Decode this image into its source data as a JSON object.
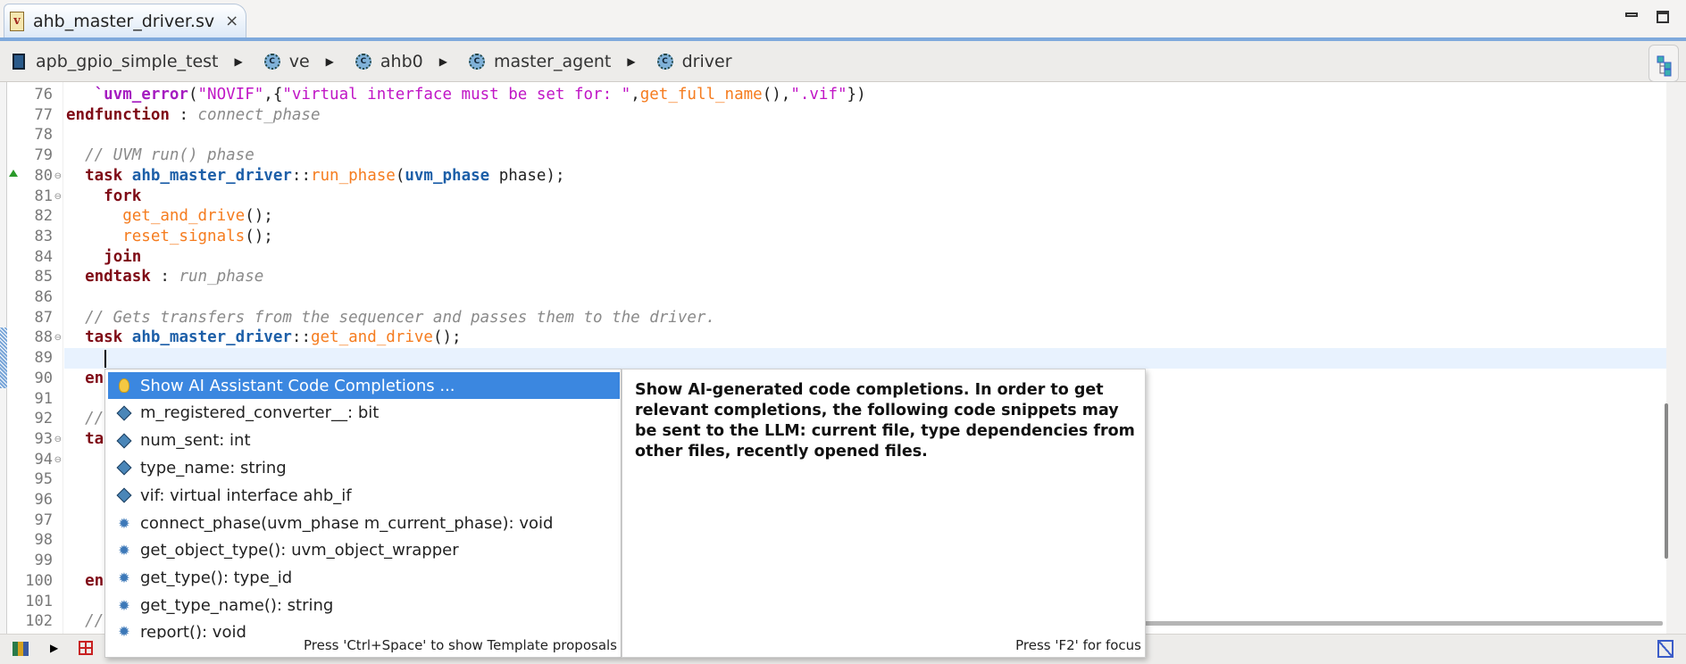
{
  "tab": {
    "title": "ahb_master_driver.sv",
    "file_icon": "sv-file-icon",
    "close": "×"
  },
  "breadcrumb": [
    "apb_gpio_simple_test",
    "ve",
    "ahb0",
    "master_agent",
    "driver"
  ],
  "code": {
    "lines": [
      "76",
      "77",
      "78",
      "79",
      "80",
      "81",
      "82",
      "83",
      "84",
      "85",
      "86",
      "87",
      "88",
      "89",
      "90",
      "91",
      "92",
      "93",
      "94",
      "95",
      "96",
      "97",
      "98",
      "99",
      "100",
      "101",
      "102"
    ],
    "l76": {
      "indent": "   ",
      "macro": "`uvm_error",
      "p1": "(",
      "s1": "\"NOVIF\"",
      "p2": ",{",
      "s2": "\"virtual interface must be set for: \"",
      "p3": ",",
      "f": "get_full_name",
      "p4": "(),",
      "s3": "\".vif\"",
      "p5": "})"
    },
    "l77": {
      "kw": "endfunction",
      "sep": " : ",
      "cm": "connect_phase"
    },
    "l79": "// UVM run() phase",
    "l80": {
      "kw": "task",
      "cls": "ahb_master_driver",
      "sep": "::",
      "fn": "run_phase",
      "p1": "(",
      "ty": "uvm_phase",
      "arg": " phase);"
    },
    "l81": "fork",
    "l82": {
      "fn": "get_and_drive",
      "p": "();"
    },
    "l83": {
      "fn": "reset_signals",
      "p": "();"
    },
    "l84": "join",
    "l85": {
      "kw": "endtask",
      "sep": " : ",
      "cm": "run_phase"
    },
    "l87": "// Gets transfers from the sequencer and passes them to the driver.",
    "l88": {
      "kw": "task",
      "cls": "ahb_master_driver",
      "sep": "::",
      "fn": "get_and_drive",
      "p": "();"
    },
    "l90": "en",
    "l92": "//",
    "l93": "ta",
    "l100": "en",
    "l102": "//"
  },
  "completion": {
    "items": [
      {
        "label": "Show AI Assistant Code Completions ...",
        "icon": "lightbulb-icon"
      },
      {
        "label": "m_registered_converter__: bit",
        "icon": "field-icon"
      },
      {
        "label": "num_sent: int",
        "icon": "field-icon"
      },
      {
        "label": "type_name: string",
        "icon": "field-icon"
      },
      {
        "label": "vif: virtual interface ahb_if",
        "icon": "field-icon"
      },
      {
        "label": "connect_phase(uvm_phase m_current_phase): void",
        "icon": "method-icon"
      },
      {
        "label": "get_object_type(): uvm_object_wrapper",
        "icon": "method-icon"
      },
      {
        "label": "get_type(): type_id",
        "icon": "method-icon"
      },
      {
        "label": "get_type_name(): string",
        "icon": "method-icon"
      },
      {
        "label": "report(): void",
        "icon": "method-icon"
      }
    ],
    "footer": "Press 'Ctrl+Space' to show Template proposals"
  },
  "docs": {
    "text": "Show AI-generated code completions. In order to get relevant completions, the following code snippets may be sent to the LLM: current file, type dependencies from other files, recently opened files.",
    "footer": "Press 'F2' for focus"
  },
  "colors": {
    "selection": "#3b87e0",
    "keyword": "#7f0a16",
    "type": "#1d5fa8",
    "function": "#f57c1f",
    "string": "#c016c6",
    "comment": "#8a8a8a"
  }
}
